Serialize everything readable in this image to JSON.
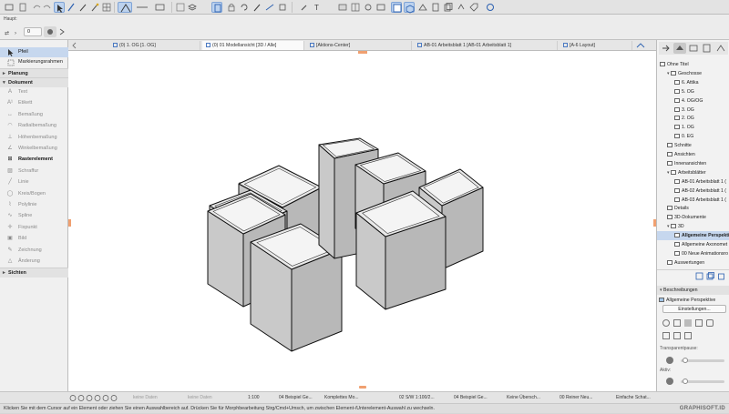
{
  "toolbar": {
    "layer_label": "Haupt:",
    "layer_value": "0"
  },
  "tabs": [
    {
      "label": "(0) 1. OG [1. OG]"
    },
    {
      "label": "(0) 01 Modellansicht [3D / Alle]"
    },
    {
      "label": "[Aktions-Center]"
    },
    {
      "label": "AB-01 Arbeitsblatt 1 [AB-01 Arbeitsblatt 1]"
    },
    {
      "label": "[A-6 Layout]"
    }
  ],
  "left_panel": {
    "arrow_tool": "Pfeil",
    "marquee_tool": "Markierungsrahmen",
    "section_planning": "Planung",
    "section_document": "Dokument",
    "tools": [
      {
        "label": "Text",
        "icon": "text-icon"
      },
      {
        "label": "Etikett",
        "icon": "label-icon"
      },
      {
        "label": "Bemaßung",
        "icon": "dimension-icon"
      },
      {
        "label": "Radialbemaßung",
        "icon": "radial-dimension-icon"
      },
      {
        "label": "Höhenbemaßung",
        "icon": "level-dimension-icon"
      },
      {
        "label": "Winkelbemaßung",
        "icon": "angle-dimension-icon"
      },
      {
        "label": "Rasterelement",
        "icon": "grid-element-icon",
        "selected": true
      },
      {
        "label": "Schraffur",
        "icon": "fill-icon"
      },
      {
        "label": "Linie",
        "icon": "line-icon"
      },
      {
        "label": "Kreis/Bogen",
        "icon": "arc-icon"
      },
      {
        "label": "Polylinie",
        "icon": "polyline-icon"
      },
      {
        "label": "Spline",
        "icon": "spline-icon"
      },
      {
        "label": "Fixpunkt",
        "icon": "hotspot-icon"
      },
      {
        "label": "Bild",
        "icon": "figure-icon"
      },
      {
        "label": "Zeichnung",
        "icon": "drawing-icon"
      },
      {
        "label": "Änderung",
        "icon": "change-icon"
      }
    ],
    "section_views": "Sichten"
  },
  "navigator": {
    "tree": [
      {
        "label": "Ohne Titel",
        "level": 0,
        "icon": "project-icon"
      },
      {
        "label": "Geschosse",
        "level": 1,
        "icon": "stories-icon"
      },
      {
        "label": "6. Attika",
        "level": 2
      },
      {
        "label": "5. OG",
        "level": 2
      },
      {
        "label": "4. OG/OG",
        "level": 2
      },
      {
        "label": "3. OG",
        "level": 2
      },
      {
        "label": "2. OG",
        "level": 2
      },
      {
        "label": "1. OG",
        "level": 2
      },
      {
        "label": "0. EG",
        "level": 2
      },
      {
        "label": "Schnitte",
        "level": 1
      },
      {
        "label": "Ansichten",
        "level": 1
      },
      {
        "label": "Innenansichten",
        "level": 1
      },
      {
        "label": "Arbeitsblätter",
        "level": 1
      },
      {
        "label": "AB-01 Arbeitsblatt 1 (",
        "level": 2
      },
      {
        "label": "AB-02 Arbeitsblatt 1 (",
        "level": 2
      },
      {
        "label": "AB-03 Arbeitsblatt 1 (",
        "level": 2
      },
      {
        "label": "Details",
        "level": 1
      },
      {
        "label": "3D-Dokumente",
        "level": 1
      },
      {
        "label": "3D",
        "level": 1
      },
      {
        "label": "Allgemeine Perspekti",
        "level": 2,
        "selected": true
      },
      {
        "label": "Allgemeine Axonomet",
        "level": 2
      },
      {
        "label": "00 Neue Animationsro",
        "level": 2
      },
      {
        "label": "Auswertungen",
        "level": 1
      }
    ],
    "descriptions_header": "Beschreibungen",
    "view_name": "Allgemeine Perspektive",
    "settings_button": "Einstellungen...",
    "transparency_label": "Transparentpause:",
    "active_label": "Aktiv:"
  },
  "status": {
    "zoom": "1:100",
    "items": [
      "keine Daten",
      "keine Daten",
      "1:100",
      "04 Beispiel Ge...",
      "Komplettes Mo...",
      "02 S/W 1:100/2...",
      "04 Beispiel Ge...",
      "Keine Übersch...",
      "00 Reiner Neu...",
      "Einfache Schat..."
    ]
  },
  "hint": "Klicken Sie mit dem Cursor auf ein Element oder ziehen Sie einen Auswahlbereich auf. Drücken Sie für Morphbearbeitung Strg/Cmd+Umsch, um zwischen Element-/Unterelement-Auswahl zu wechseln.",
  "brand": "GRAPHISOFT.ID",
  "colors": {
    "accent": "#4a79c2",
    "selection": "#c6d7ee",
    "model_side": "#b8b8b8",
    "model_top": "#e9e9e9"
  }
}
